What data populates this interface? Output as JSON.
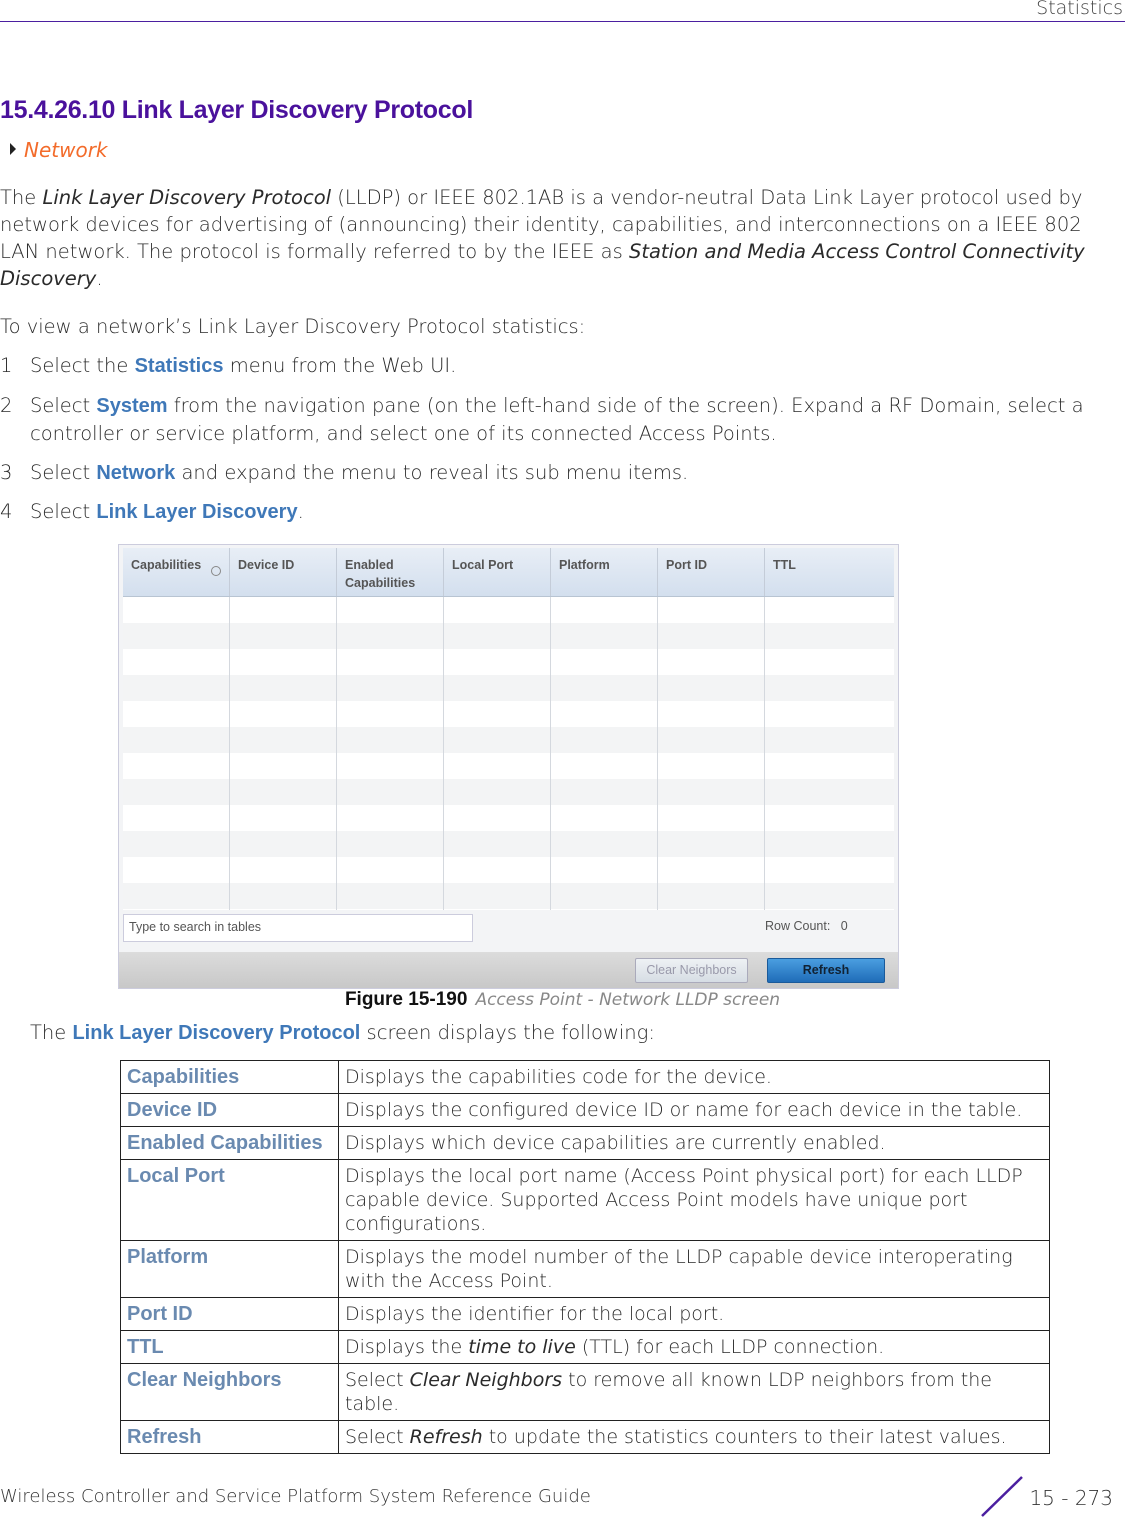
{
  "header": {
    "section": "Statistics"
  },
  "title": "15.4.26.10  Link Layer Discovery Protocol",
  "breadcrumb": "Network",
  "intro": {
    "p1a": "The ",
    "p1b": "Link Layer Discovery Protocol",
    "p1c": " (LLDP) or IEEE 802.1AB is a vendor-neutral Data Link Layer protocol used by network devices for advertising of (announcing) their identity, capabilities, and interconnections on a IEEE 802 LAN network. The protocol is formally referred to by the IEEE as ",
    "p1d": "Station and Media Access Control Connectivity Discovery",
    "p1e": ".",
    "p2": "To view a network’s Link Layer Discovery Protocol statistics:"
  },
  "steps": [
    {
      "n": "1",
      "a": "Select the ",
      "k": "Statistics",
      "b": " menu from the Web UI."
    },
    {
      "n": "2",
      "a": "Select ",
      "k": "System",
      "b": " from the navigation pane (on the left-hand side of the screen). Expand a RF Domain, select a controller or service platform, and select one of its connected Access Points."
    },
    {
      "n": "3",
      "a": "Select ",
      "k": "Network",
      "b": " and expand the menu to reveal its sub menu items."
    },
    {
      "n": "4",
      "a": "Select ",
      "k": "Link Layer Discovery",
      "b": "."
    }
  ],
  "figure": {
    "columns": [
      "Capabilities",
      "Device ID",
      "Enabled Capabilities",
      "Local Port",
      "Platform",
      "Port ID",
      "TTL"
    ],
    "search_placeholder": "Type to search in tables",
    "row_count_label": "Row Count:",
    "row_count": "0",
    "clear_button": "Clear Neighbors",
    "refresh_button": "Refresh",
    "caption_num": "Figure 15-190",
    "caption_text": "Access Point - Network LLDP screen"
  },
  "after_fig": {
    "a": "The ",
    "k": "Link Layer Discovery Protocol",
    "b": " screen displays the following:"
  },
  "table": [
    {
      "k": "Capabilities",
      "v": "Displays the capabilities code for the device."
    },
    {
      "k": "Device ID",
      "v": "Displays the configured device ID or name for each device in the table."
    },
    {
      "k": "Enabled Capabilities",
      "v": "Displays which device capabilities are currently enabled."
    },
    {
      "k": "Local Port",
      "v": "Displays the local port name (Access Point physical port) for each LLDP capable device. Supported Access Point models have unique port configurations."
    },
    {
      "k": "Platform",
      "v": "Displays the model number of the LLDP capable device interoperating with the Access Point."
    },
    {
      "k": "Port ID",
      "v": "Displays the identifier for the local port."
    },
    {
      "k": "TTL",
      "va": "Displays the ",
      "vi": "time to live",
      "vb": " (TTL) for each LLDP connection."
    },
    {
      "k": "Clear Neighbors",
      "va": "Select ",
      "vi": "Clear Neighbors",
      "vb": " to remove all known LDP neighbors from the table."
    },
    {
      "k": "Refresh",
      "va": "Select ",
      "vi": "Refresh",
      "vb": " to update the statistics counters to their latest values."
    }
  ],
  "footer": {
    "guide": "Wireless Controller and Service Platform System Reference Guide",
    "page": "15 - 273"
  },
  "colors": {
    "title": "#4a119c",
    "breadcrumb": "#f36b2a",
    "keyword": "#3f78b8",
    "table_key": "#6a8ab0"
  }
}
